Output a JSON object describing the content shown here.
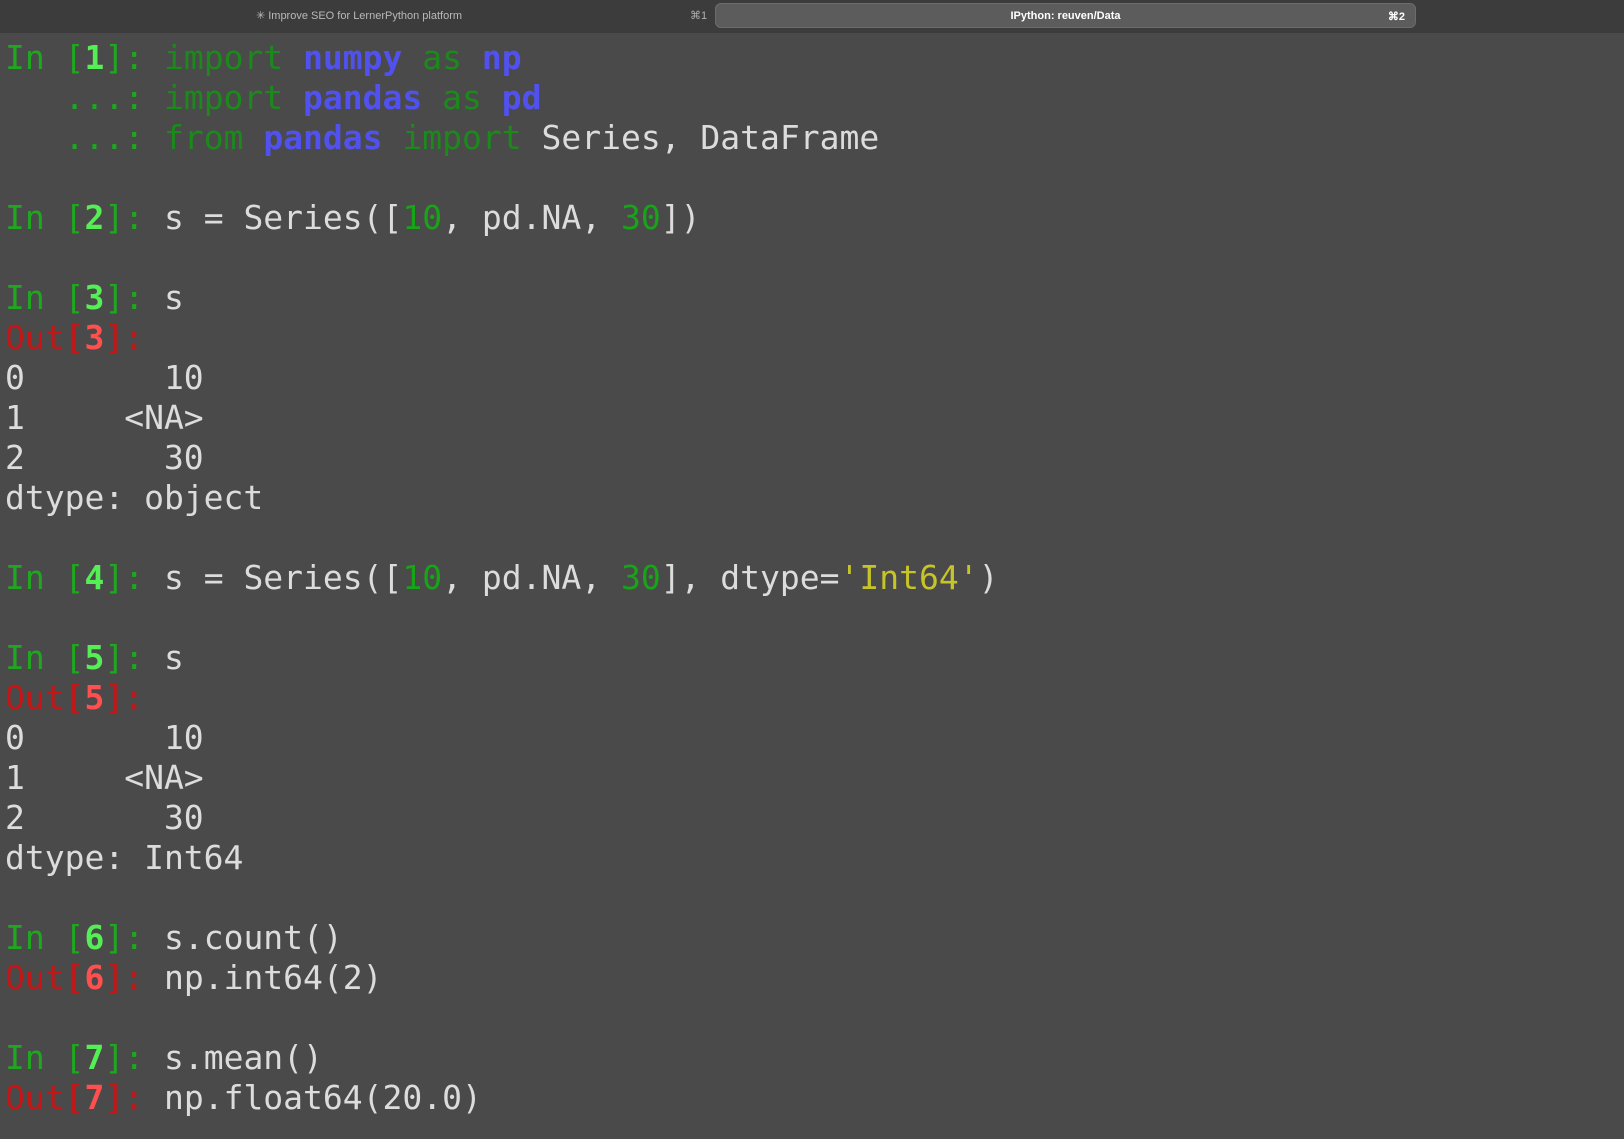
{
  "tabs": [
    {
      "spinner": "✳",
      "title": "Improve SEO for LernerPython platform",
      "shortcut": "⌘1",
      "active": false
    },
    {
      "title": "IPython: reuven/Data",
      "shortcut": "⌘2",
      "active": true
    }
  ],
  "session": {
    "lines": [
      [
        {
          "t": "In [",
          "c": "pin"
        },
        {
          "t": "1",
          "c": "pnum"
        },
        {
          "t": "]: ",
          "c": "pin"
        },
        {
          "t": "import",
          "c": "kw"
        },
        {
          "t": " ",
          "c": "txt"
        },
        {
          "t": "numpy",
          "c": "mod"
        },
        {
          "t": " ",
          "c": "txt"
        },
        {
          "t": "as",
          "c": "kw"
        },
        {
          "t": " ",
          "c": "txt"
        },
        {
          "t": "np",
          "c": "mod"
        }
      ],
      [
        {
          "t": "   ...: ",
          "c": "pin"
        },
        {
          "t": "import",
          "c": "kw"
        },
        {
          "t": " ",
          "c": "txt"
        },
        {
          "t": "pandas",
          "c": "mod"
        },
        {
          "t": " ",
          "c": "txt"
        },
        {
          "t": "as",
          "c": "kw"
        },
        {
          "t": " ",
          "c": "txt"
        },
        {
          "t": "pd",
          "c": "mod"
        }
      ],
      [
        {
          "t": "   ...: ",
          "c": "pin"
        },
        {
          "t": "from",
          "c": "kw"
        },
        {
          "t": " ",
          "c": "txt"
        },
        {
          "t": "pandas",
          "c": "mod"
        },
        {
          "t": " ",
          "c": "txt"
        },
        {
          "t": "import",
          "c": "kw"
        },
        {
          "t": " Series, DataFrame",
          "c": "txt"
        }
      ],
      [],
      [
        {
          "t": "In [",
          "c": "pin"
        },
        {
          "t": "2",
          "c": "pnum"
        },
        {
          "t": "]: ",
          "c": "pin"
        },
        {
          "t": "s = Series([",
          "c": "txt"
        },
        {
          "t": "10",
          "c": "num"
        },
        {
          "t": ", pd.NA, ",
          "c": "txt"
        },
        {
          "t": "30",
          "c": "num"
        },
        {
          "t": "])",
          "c": "txt"
        }
      ],
      [],
      [
        {
          "t": "In [",
          "c": "pin"
        },
        {
          "t": "3",
          "c": "pnum"
        },
        {
          "t": "]: ",
          "c": "pin"
        },
        {
          "t": "s",
          "c": "txt"
        }
      ],
      [
        {
          "t": "Out[",
          "c": "pout"
        },
        {
          "t": "3",
          "c": "onum"
        },
        {
          "t": "]:",
          "c": "pout"
        }
      ],
      [
        {
          "t": "0       10",
          "c": "txt"
        }
      ],
      [
        {
          "t": "1     <NA>",
          "c": "txt"
        }
      ],
      [
        {
          "t": "2       30",
          "c": "txt"
        }
      ],
      [
        {
          "t": "dtype: object",
          "c": "txt"
        }
      ],
      [],
      [
        {
          "t": "In [",
          "c": "pin"
        },
        {
          "t": "4",
          "c": "pnum"
        },
        {
          "t": "]: ",
          "c": "pin"
        },
        {
          "t": "s = Series([",
          "c": "txt"
        },
        {
          "t": "10",
          "c": "num"
        },
        {
          "t": ", pd.NA, ",
          "c": "txt"
        },
        {
          "t": "30",
          "c": "num"
        },
        {
          "t": "], dtype=",
          "c": "txt"
        },
        {
          "t": "'Int64'",
          "c": "str"
        },
        {
          "t": ")",
          "c": "txt"
        }
      ],
      [],
      [
        {
          "t": "In [",
          "c": "pin"
        },
        {
          "t": "5",
          "c": "pnum"
        },
        {
          "t": "]: ",
          "c": "pin"
        },
        {
          "t": "s",
          "c": "txt"
        }
      ],
      [
        {
          "t": "Out[",
          "c": "pout"
        },
        {
          "t": "5",
          "c": "onum"
        },
        {
          "t": "]:",
          "c": "pout"
        }
      ],
      [
        {
          "t": "0       10",
          "c": "txt"
        }
      ],
      [
        {
          "t": "1     <NA>",
          "c": "txt"
        }
      ],
      [
        {
          "t": "2       30",
          "c": "txt"
        }
      ],
      [
        {
          "t": "dtype: Int64",
          "c": "txt"
        }
      ],
      [],
      [
        {
          "t": "In [",
          "c": "pin"
        },
        {
          "t": "6",
          "c": "pnum"
        },
        {
          "t": "]: ",
          "c": "pin"
        },
        {
          "t": "s.count()",
          "c": "txt"
        }
      ],
      [
        {
          "t": "Out[",
          "c": "pout"
        },
        {
          "t": "6",
          "c": "onum"
        },
        {
          "t": "]: ",
          "c": "pout"
        },
        {
          "t": "np.int64(2)",
          "c": "txt"
        }
      ],
      [],
      [
        {
          "t": "In [",
          "c": "pin"
        },
        {
          "t": "7",
          "c": "pnum"
        },
        {
          "t": "]: ",
          "c": "pin"
        },
        {
          "t": "s.mean()",
          "c": "txt"
        }
      ],
      [
        {
          "t": "Out[",
          "c": "pout"
        },
        {
          "t": "7",
          "c": "onum"
        },
        {
          "t": "]: ",
          "c": "pout"
        },
        {
          "t": "np.float64(20.0)",
          "c": "txt"
        }
      ]
    ]
  }
}
